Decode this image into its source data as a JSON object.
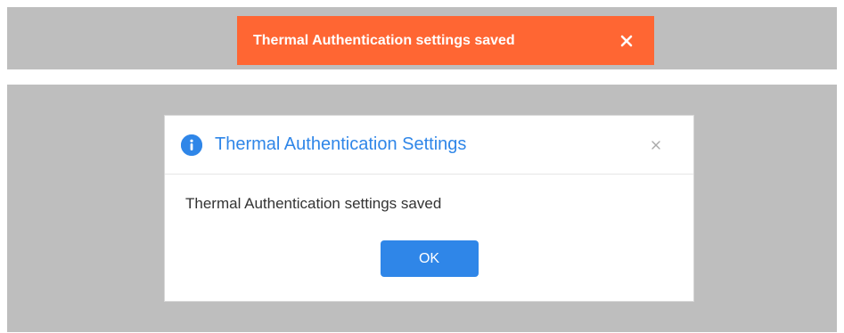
{
  "toast": {
    "message": "Thermal Authentication settings saved",
    "close_icon": "close-icon",
    "colors": {
      "background": "#ff6633",
      "text": "#ffffff"
    }
  },
  "dialog": {
    "icon": "info-icon",
    "title": "Thermal Authentication Settings",
    "close_icon": "close-icon",
    "message": "Thermal Authentication settings saved",
    "ok_label": "OK",
    "colors": {
      "accent": "#2f86e8",
      "text": "#333333"
    }
  }
}
